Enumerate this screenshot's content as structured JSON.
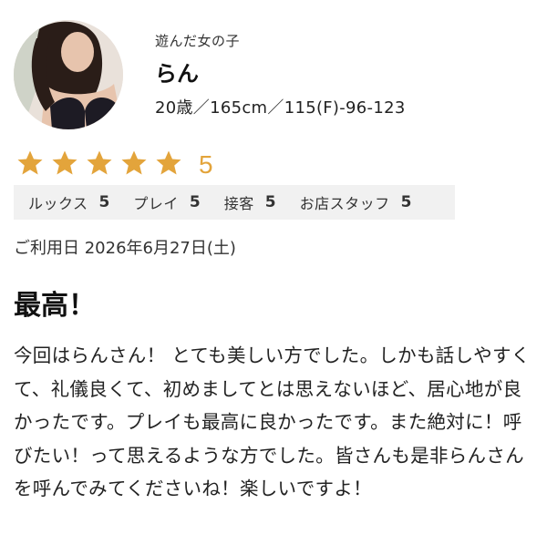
{
  "profile": {
    "played_label": "遊んだ女の子",
    "name": "らん",
    "stats": "20歳／165cm／115(F)-96-123"
  },
  "rating": {
    "stars": 5,
    "max_stars": 5,
    "value": "5",
    "star_color": "#e3a43b"
  },
  "details": [
    {
      "label": "ルックス",
      "score": "5"
    },
    {
      "label": "プレイ",
      "score": "5"
    },
    {
      "label": "接客",
      "score": "5"
    },
    {
      "label": "お店スタッフ",
      "score": "5"
    }
  ],
  "visit_date": "ご利用日 2026年6月27日(土)",
  "review": {
    "title": "最高！",
    "body": "今回はらんさん！ とても美しい方でした。しかも話しやすくて、礼儀良くて、初めましてとは思えないほど、居心地が良かったです。プレイも最高に良かったです。また絶対に！呼びたい！って思えるような方でした。皆さんも是非らんさんを呼んでみてくださいね！楽しいですよ！"
  }
}
